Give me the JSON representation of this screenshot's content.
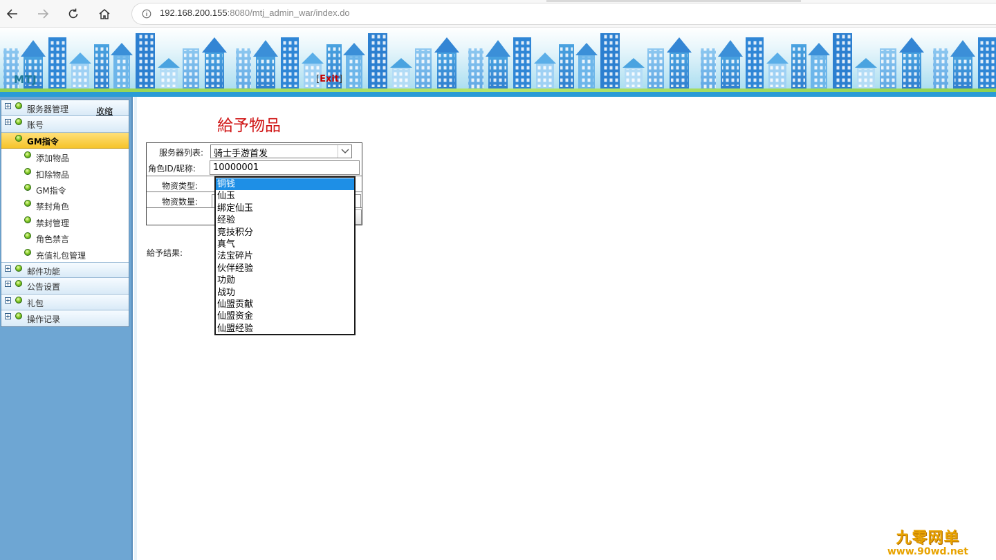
{
  "browser": {
    "url_host": "192.168.200.155",
    "url_rest": ":8080/mtj_admin_war/index.do"
  },
  "header": {
    "logo": "MTJ",
    "exit_bracket_open": "[",
    "exit_label": "Exit",
    "exit_bracket_close": "]"
  },
  "sidebar": {
    "collapse_label": "收缩",
    "sections": [
      {
        "label": "服务器管理"
      },
      {
        "label": "账号"
      }
    ],
    "active_section": {
      "label": "GM指令"
    },
    "sub_items": [
      {
        "label": "添加物品"
      },
      {
        "label": "扣除物品"
      },
      {
        "label": "GM指令"
      },
      {
        "label": "禁封角色"
      },
      {
        "label": "禁封管理"
      },
      {
        "label": "角色禁言"
      },
      {
        "label": "充值礼包管理"
      }
    ],
    "bottom_sections": [
      {
        "label": "邮件功能"
      },
      {
        "label": "公告设置"
      },
      {
        "label": "礼包"
      },
      {
        "label": "操作记录"
      }
    ]
  },
  "main": {
    "title": "給予物品",
    "form": {
      "server_label": "服务器列表:",
      "server_value": "骑士手游首发",
      "role_label": "角色ID/昵称:",
      "role_value": "10000001",
      "type_label": "物资类型:",
      "qty_label": "物资数量:"
    },
    "result_label": "給予结果:",
    "type_options": [
      "铜钱",
      "仙玉",
      "绑定仙玉",
      "经验",
      "竞技积分",
      "真气",
      "法宝碎片",
      "伙伴经验",
      "功勋",
      "战功",
      "仙盟贡献",
      "仙盟资金",
      "仙盟经验"
    ]
  },
  "watermark": {
    "line1": "九零网单",
    "line2": "www.90wd.net"
  }
}
